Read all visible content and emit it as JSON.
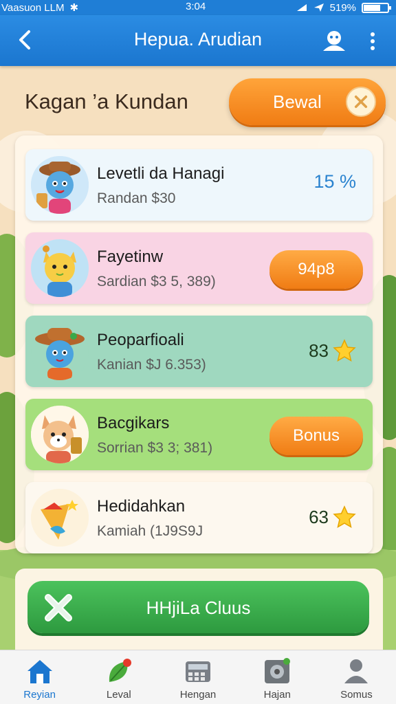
{
  "status_bar": {
    "carrier": "Vaasuon LLM",
    "time": "3:04",
    "battery": "519%"
  },
  "app_bar": {
    "title": "Hepua. Arudian"
  },
  "header": {
    "headline": "Kagan ’a Kundan",
    "reveal_button": "Bewal"
  },
  "list": [
    {
      "name": "Levetli da Hanagi",
      "subtitle": "Randan $30",
      "value": "15 %",
      "value_type": "percent",
      "bg": "#eef7fc"
    },
    {
      "name": "Fayetinw",
      "subtitle": "Sardian $3 5, 389)",
      "value": "94p8",
      "value_type": "pill",
      "bg": "#f9d4e4"
    },
    {
      "name": "Peoparfioali",
      "subtitle": "Kanian $J 6.353)",
      "value": "83",
      "value_type": "star",
      "bg": "#9fd8bf"
    },
    {
      "name": "Bacgikars",
      "subtitle": "Sorrian $3 3; 381)",
      "value": "Bonus",
      "value_type": "pill",
      "bg": "#a5df7c"
    },
    {
      "name": "Hedidahkan",
      "subtitle": "Kamiah (1J9S9J",
      "value": "63",
      "value_type": "star",
      "bg": "#fdf8ef"
    }
  ],
  "action_button": {
    "label": "HHjiLa Cluus"
  },
  "bottom_nav": [
    {
      "label": "Reyian",
      "icon": "home-icon",
      "active": true
    },
    {
      "label": "Leval",
      "icon": "leaf-icon",
      "active": false
    },
    {
      "label": "Hengan",
      "icon": "calculator-icon",
      "active": false
    },
    {
      "label": "Hajan",
      "icon": "safe-icon",
      "active": false
    },
    {
      "label": "Somus",
      "icon": "user-icon",
      "active": false
    }
  ],
  "colors": {
    "primary": "#1f7ed6",
    "accent_orange": "#f07c14",
    "accent_green": "#2d9a3f",
    "percent_blue": "#2a83cf"
  }
}
